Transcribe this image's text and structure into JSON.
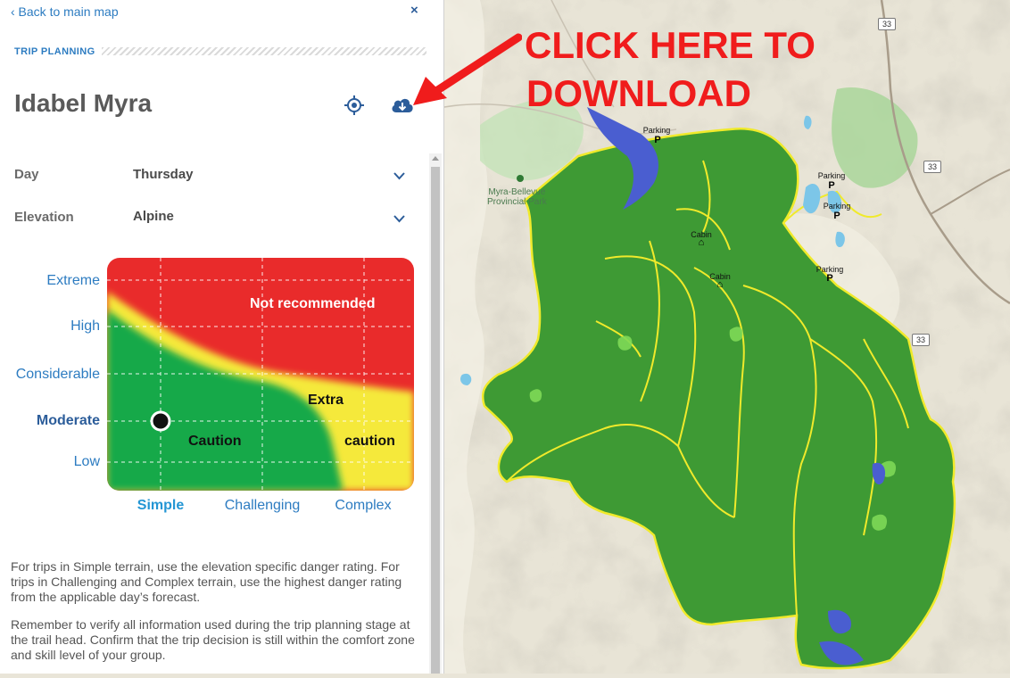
{
  "panel": {
    "back_label": "‹ Back to main map",
    "close_label": "×",
    "section_label": "TRIP PLANNING",
    "title": "Idabel Myra",
    "fields": {
      "day": {
        "label": "Day",
        "value": "Thursday"
      },
      "elevation": {
        "label": "Elevation",
        "value": "Alpine"
      }
    },
    "icons": {
      "locate": "crosshair-icon",
      "download": "cloud-download-icon",
      "chevron": "chevron-down-icon"
    }
  },
  "chart": {
    "danger_levels": [
      "Extreme",
      "High",
      "Considerable",
      "Moderate",
      "Low"
    ],
    "selected_danger": "Moderate",
    "terrain_types": [
      "Simple",
      "Challenging",
      "Complex"
    ],
    "selected_terrain": "Simple",
    "zones": {
      "red": "Not recommended",
      "yellow_line1": "Extra",
      "yellow_line2": "caution",
      "green": "Caution"
    },
    "colors": {
      "red": "#e92b2b",
      "yellow": "#f5e93a",
      "green": "#15a94a"
    }
  },
  "info": {
    "para1": "For trips in Simple terrain, use the elevation specific danger rating. For trips in Challenging and Complex terrain, use the highest danger rating from the applicable day’s forecast.",
    "para2": "Remember to verify all information used during the trip planning stage at the trail head. Confirm that the trip decision is still within the comfort zone and skill level of your group."
  },
  "map": {
    "callout_line1": "CLICK HERE TO",
    "callout_line2": "DOWNLOAD",
    "park_label_line1": "Myra-Bellevue",
    "park_label_line2": "Provincial Park",
    "highway": "33",
    "parking_label": "Parking",
    "parking_symbol": "P",
    "cabin_label": "Cabin",
    "cabin_symbol": "⌂"
  }
}
